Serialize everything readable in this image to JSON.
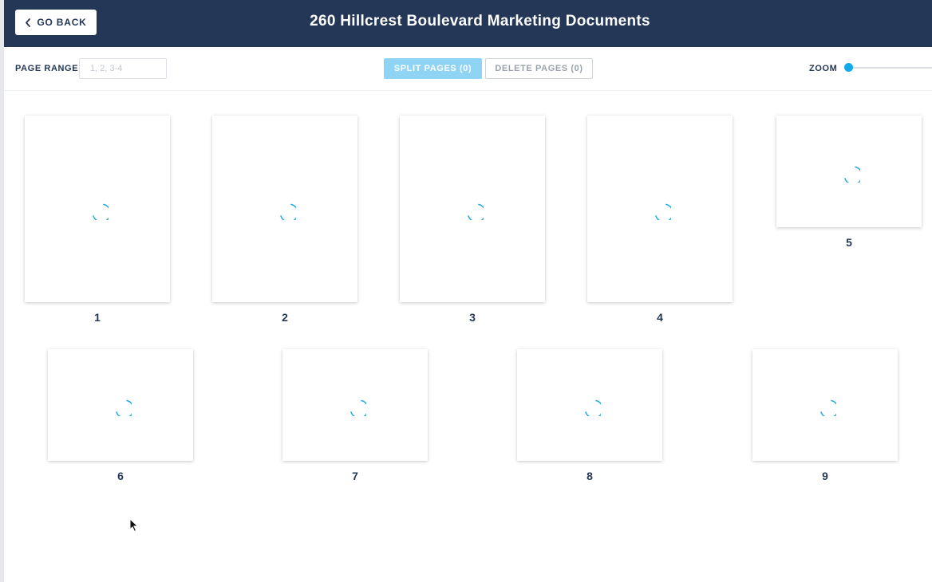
{
  "header": {
    "back_label": "GO BACK",
    "title": "260 Hillcrest Boulevard Marketing Documents"
  },
  "toolbar": {
    "page_range_label": "PAGE RANGE",
    "page_range_placeholder": "1, 2, 3-4",
    "page_range_value": "",
    "split_label": "SPLIT PAGES (0)",
    "delete_label": "DELETE PAGES (0)",
    "zoom_label": "ZOOM",
    "zoom_level": 0
  },
  "pages": [
    {
      "number": "1",
      "status": "loading"
    },
    {
      "number": "2",
      "status": "loading"
    },
    {
      "number": "3",
      "status": "loading"
    },
    {
      "number": "4",
      "status": "loading"
    },
    {
      "number": "5",
      "status": "loading"
    },
    {
      "number": "6",
      "status": "loading"
    },
    {
      "number": "7",
      "status": "loading"
    },
    {
      "number": "8",
      "status": "loading"
    },
    {
      "number": "9",
      "status": "loading"
    }
  ],
  "colors": {
    "header_bg": "#243757",
    "accent": "#12a9ea",
    "split_button_bg": "#8fd4f5",
    "spinner": "#29abe2"
  },
  "icons": {
    "back": "chevron-left-icon",
    "loading": "spinner-icon",
    "cursor": "mouse-pointer-icon"
  }
}
